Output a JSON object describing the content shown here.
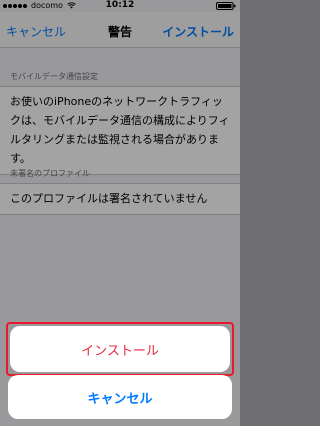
{
  "status_bar": {
    "carrier": "docomo",
    "time": "10:12",
    "wifi_icon": "wifi-icon",
    "battery_icon": "battery-icon"
  },
  "nav": {
    "cancel_label": "キャンセル",
    "title": "警告",
    "install_label": "インストール"
  },
  "sections": [
    {
      "header": "モバイルデータ通信設定",
      "body": "お使いのiPhoneのネットワークトラフィックは、モバイルデータ通信の構成によりフィルタリングまたは監視される場合があります。"
    },
    {
      "header": "未署名のプロファイル",
      "body": "このプロファイルは署名されていません"
    }
  ],
  "action_sheet": {
    "install_label": "インストール",
    "cancel_label": "キャンセル"
  },
  "colors": {
    "accent": "#007aff",
    "destructive": "#e8283a",
    "highlight_border": "#e8192a"
  }
}
